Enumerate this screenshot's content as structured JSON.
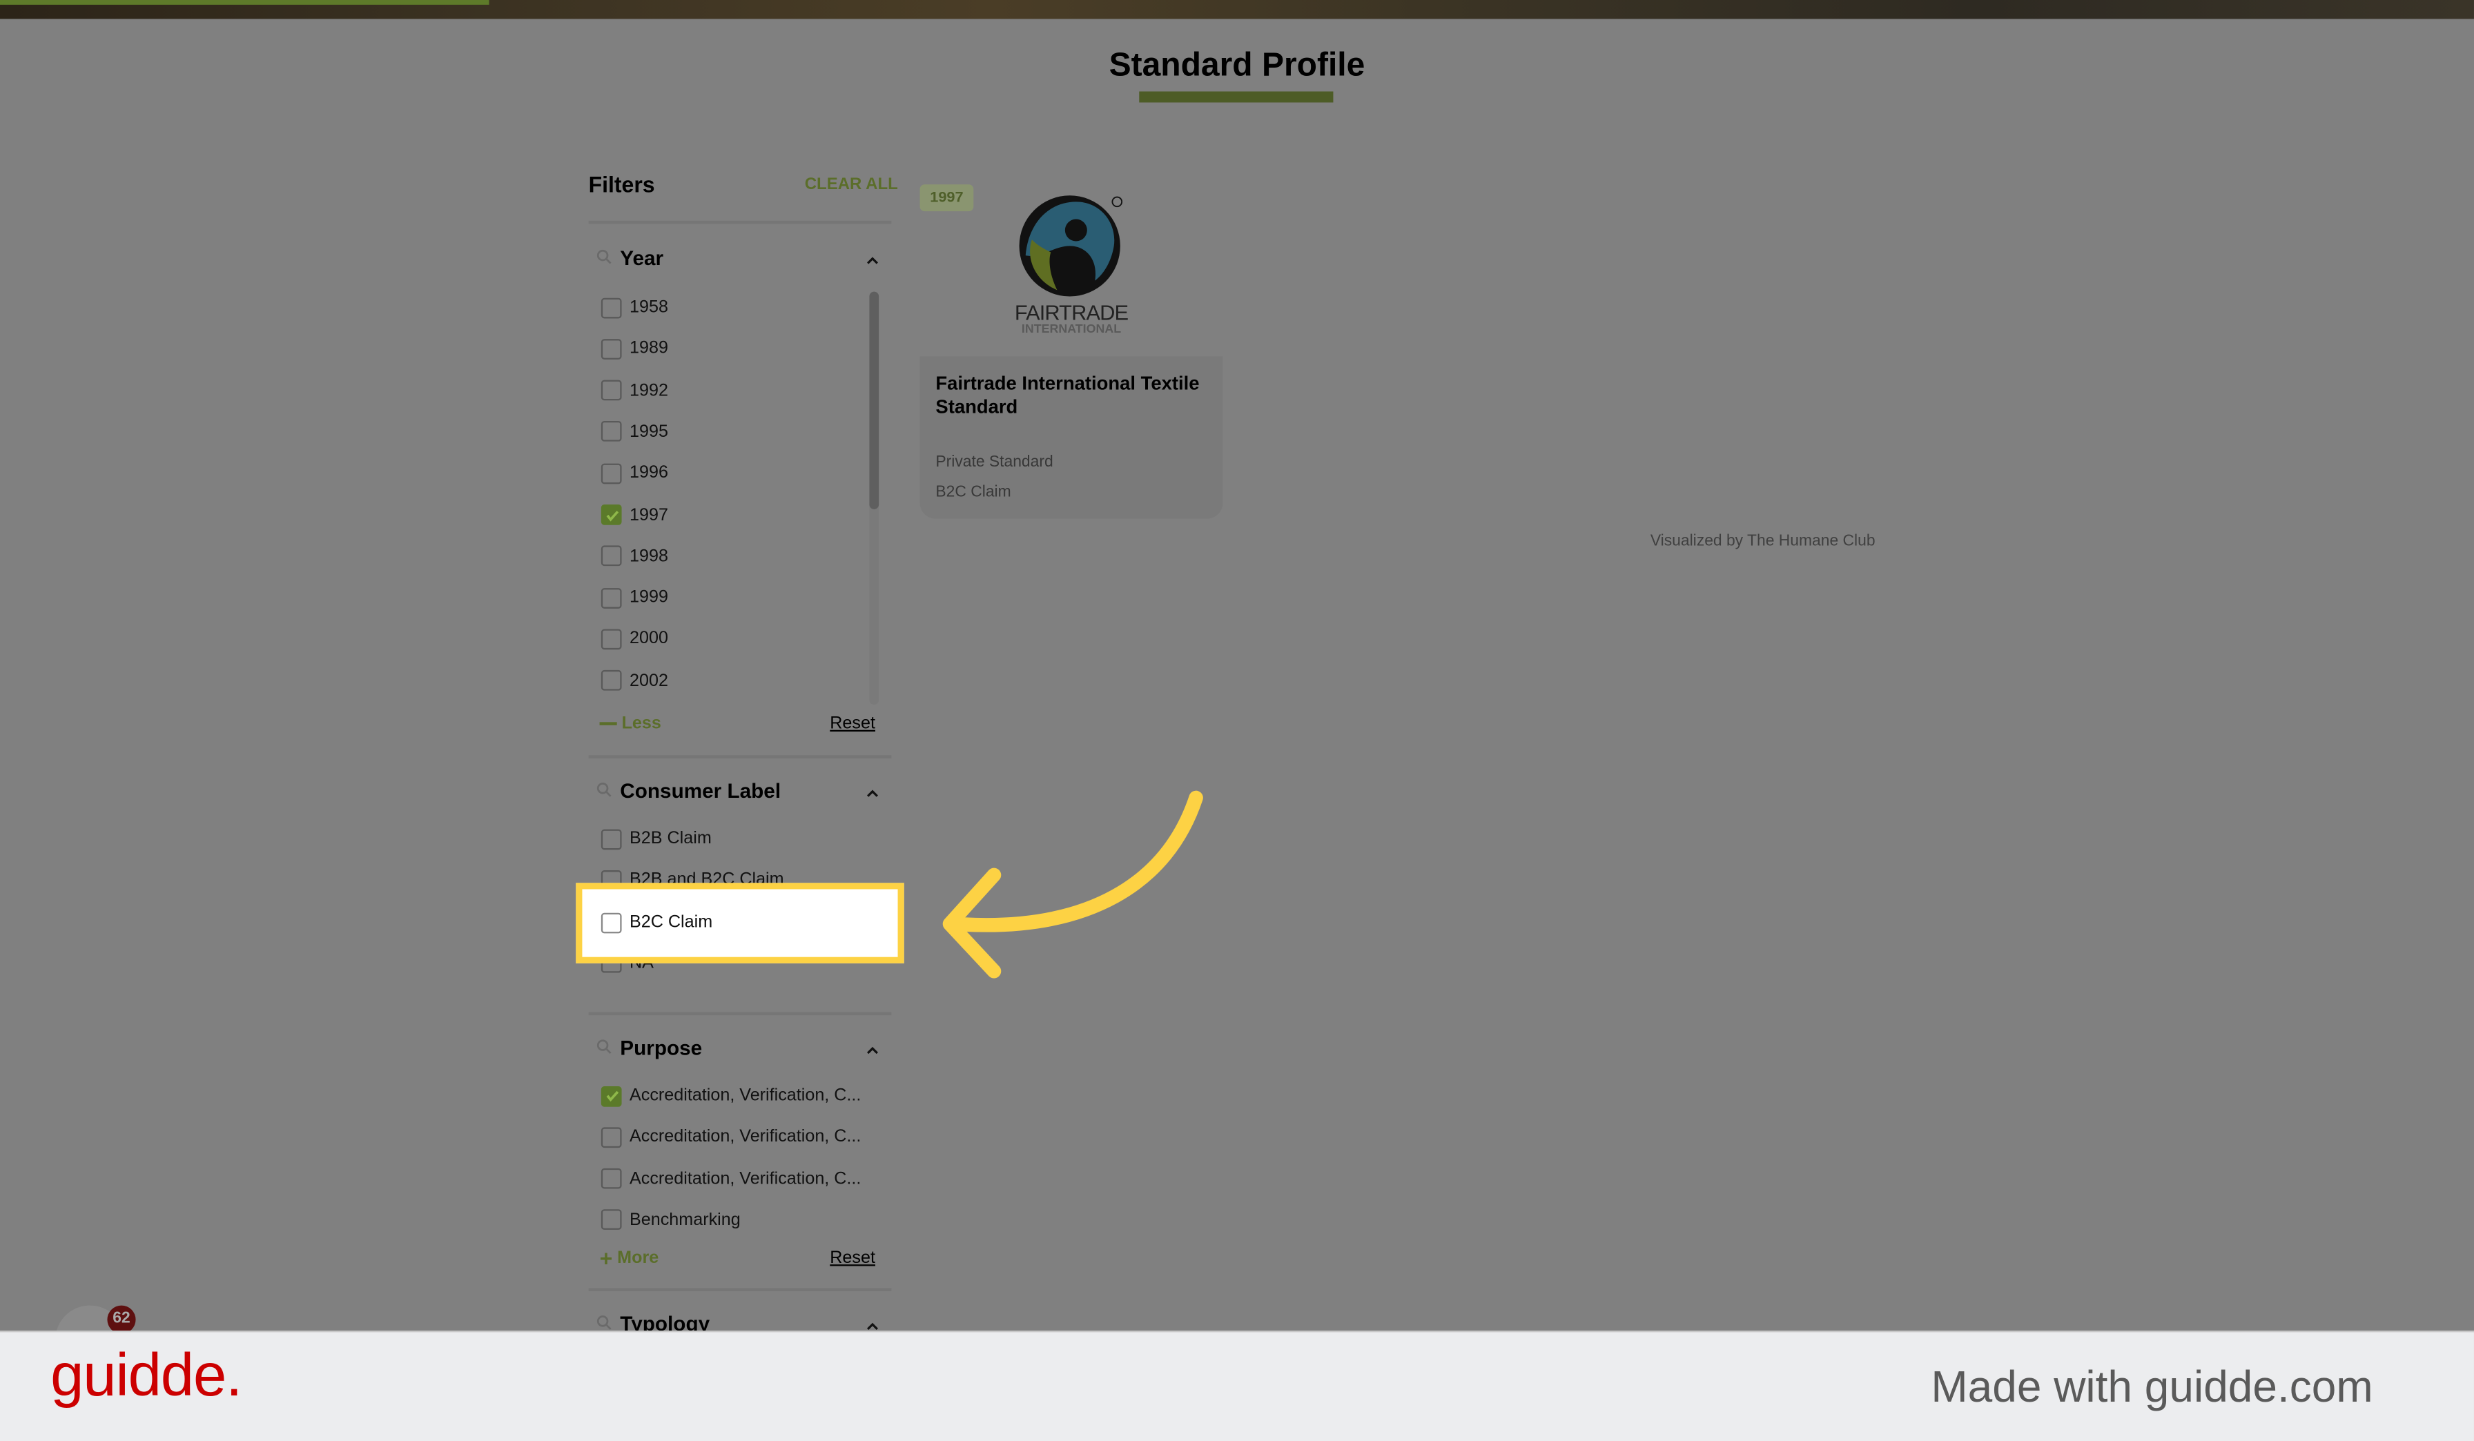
{
  "page": {
    "title": "Standard Profile"
  },
  "filters": {
    "heading": "Filters",
    "clear_all": "CLEAR ALL",
    "sections": [
      {
        "title": "Year",
        "toggle": "Less",
        "reset": "Reset",
        "items": [
          {
            "label": "1958",
            "checked": false
          },
          {
            "label": "1989",
            "checked": false
          },
          {
            "label": "1992",
            "checked": false
          },
          {
            "label": "1995",
            "checked": false
          },
          {
            "label": "1996",
            "checked": false
          },
          {
            "label": "1997",
            "checked": true
          },
          {
            "label": "1998",
            "checked": false
          },
          {
            "label": "1999",
            "checked": false
          },
          {
            "label": "2000",
            "checked": false
          },
          {
            "label": "2002",
            "checked": false
          }
        ]
      },
      {
        "title": "Consumer Label",
        "items": [
          {
            "label": "B2B Claim",
            "checked": false
          },
          {
            "label": "B2B and B2C Claim",
            "checked": false
          },
          {
            "label": "B2C Claim",
            "checked": false
          },
          {
            "label": "NA",
            "checked": false
          }
        ]
      },
      {
        "title": "Purpose",
        "toggle": "More",
        "reset": "Reset",
        "items": [
          {
            "label": "Accreditation, Verification, C...",
            "checked": true
          },
          {
            "label": "Accreditation, Verification, C...",
            "checked": false
          },
          {
            "label": "Accreditation, Verification, C...",
            "checked": false
          },
          {
            "label": "Benchmarking",
            "checked": false
          }
        ]
      },
      {
        "title": "Typology"
      }
    ]
  },
  "card": {
    "year_badge": "1997",
    "logo_text": "FAIRTRADE INTERNATIONAL",
    "title": "Fairtrade International Textile Standard",
    "type": "Private Standard",
    "claim": "B2C Claim"
  },
  "credit": "Visualized by The Humane Club",
  "notification_badge": "62",
  "footer": {
    "brand": "guidde.",
    "made_with": "Made with guidde.com"
  },
  "colors": {
    "accent": "#5b6e2a",
    "highlight": "#fdd244",
    "brand": "#cc0000",
    "overlay": "#808080"
  }
}
